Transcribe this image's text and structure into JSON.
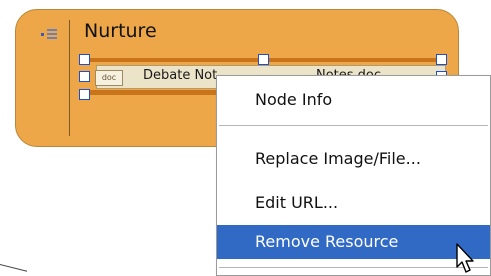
{
  "node": {
    "title": "Nurture",
    "color": "#eda748",
    "icon": "notes-icon"
  },
  "resource": {
    "icon_label": "doc",
    "label_start": "Debate Not",
    "label_end": "Notes.doc"
  },
  "context_menu": {
    "items": [
      {
        "label": "Node Info",
        "highlighted": false
      },
      {
        "label": "Replace Image/File...",
        "highlighted": false
      },
      {
        "label": "Edit URL...",
        "highlighted": false
      },
      {
        "label": "Remove Resource",
        "highlighted": true
      }
    ],
    "highlight_color": "#316ac5"
  },
  "cursor": {
    "icon": "arrow-cursor-icon"
  }
}
